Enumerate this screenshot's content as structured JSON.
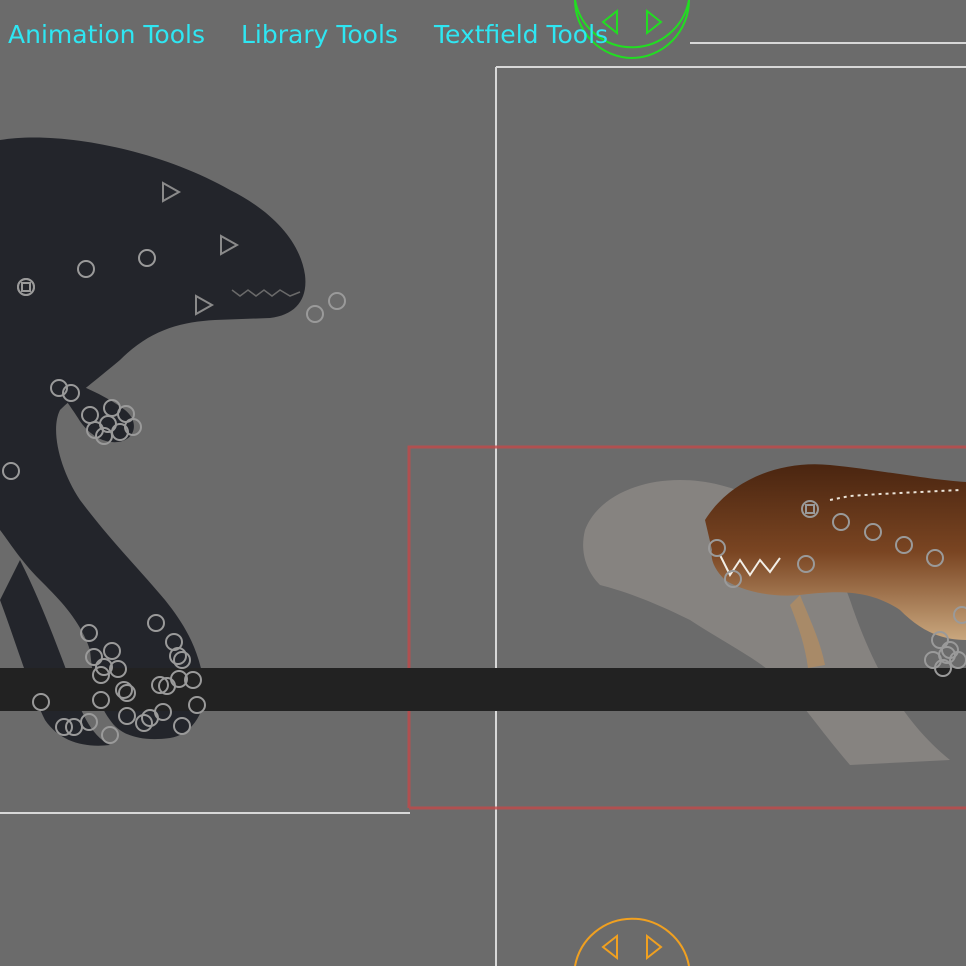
{
  "menu": {
    "items": [
      {
        "label": "Animation Tools"
      },
      {
        "label": "Library Tools"
      },
      {
        "label": "Textfield Tools"
      }
    ]
  },
  "colors": {
    "background": "#6b6b6b",
    "menu_text": "#2fe6f2",
    "timeline_green": "#22dd22",
    "timeline_orange": "#f0a020",
    "frame_white": "#e0e0e0",
    "selection_red": "#c24a4a",
    "ground": "#222222",
    "creature_dark": "#23252b",
    "creature_trex": "#6b3a1e"
  },
  "icons": {
    "top_handle": "playhead-arrows-icon",
    "bottom_handle": "playhead-arrows-icon",
    "joint": "joint-handle-icon",
    "pivot": "pivot-triangle-icon"
  }
}
